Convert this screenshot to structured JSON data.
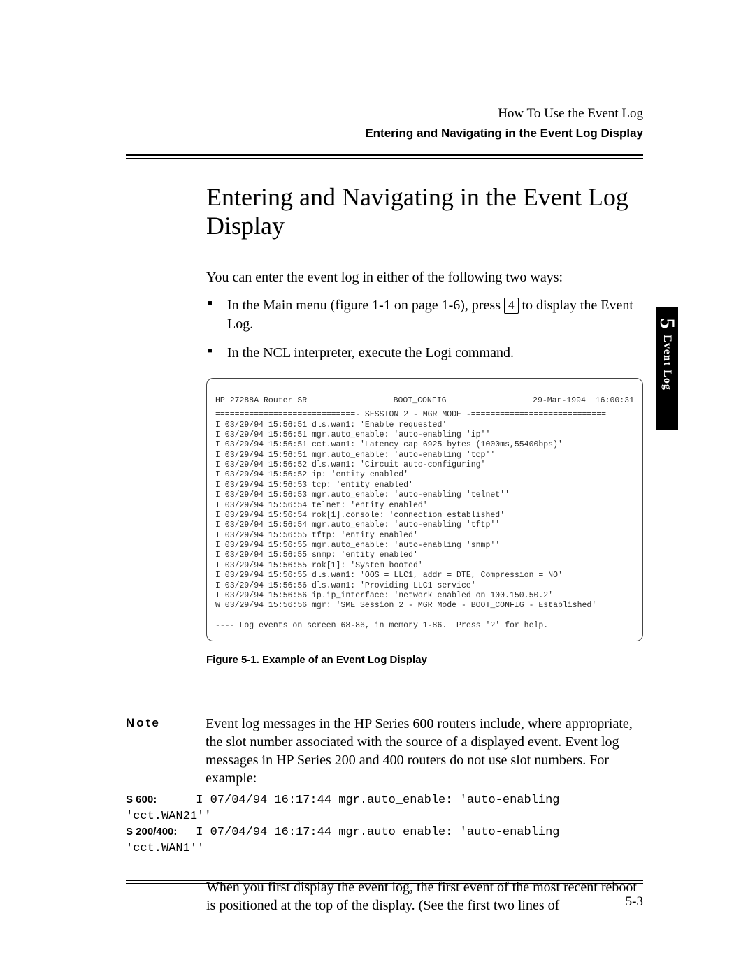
{
  "header": {
    "chapter_running_head": "How To Use the Event Log",
    "section_running_head": "Entering and Navigating in the Event Log Display"
  },
  "section": {
    "title": "Entering and Navigating in the Event Log Display",
    "intro": "You can enter the event log in either of the following two ways:",
    "bullets": {
      "b1_pre": "In the Main menu (figure 1-1 on page 1-6), press ",
      "b1_key": "4",
      "b1_post": " to display the Event Log.",
      "b2": "In the NCL interpreter, execute the Logi command."
    }
  },
  "terminal": {
    "head_left": "HP 27288A Router SR",
    "head_mid": "BOOT_CONFIG",
    "head_right": "29-Mar-1994  16:00:31",
    "rule": "=============================- SESSION 2 - MGR MODE -============================",
    "lines": [
      "I 03/29/94 15:56:51 dls.wan1: 'Enable requested'",
      "I 03/29/94 15:56:51 mgr.auto_enable: 'auto-enabling 'ip''",
      "I 03/29/94 15:56:51 cct.wan1: 'Latency cap 6925 bytes (1000ms,55400bps)'",
      "I 03/29/94 15:56:51 mgr.auto_enable: 'auto-enabling 'tcp''",
      "I 03/29/94 15:56:52 dls.wan1: 'Circuit auto-configuring'",
      "I 03/29/94 15:56:52 ip: 'entity enabled'",
      "I 03/29/94 15:56:53 tcp: 'entity enabled'",
      "I 03/29/94 15:56:53 mgr.auto_enable: 'auto-enabling 'telnet''",
      "I 03/29/94 15:56:54 telnet: 'entity enabled'",
      "I 03/29/94 15:56:54 rok[1].console: 'connection established'",
      "I 03/29/94 15:56:54 mgr.auto_enable: 'auto-enabling 'tftp''",
      "I 03/29/94 15:56:55 tftp: 'entity enabled'",
      "I 03/29/94 15:56:55 mgr.auto_enable: 'auto-enabling 'snmp''",
      "I 03/29/94 15:56:55 snmp: 'entity enabled'",
      "I 03/29/94 15:56:55 rok[1]: 'System booted'",
      "I 03/29/94 15:56:55 dls.wan1: 'OOS = LLC1, addr = DTE, Compression = NO'",
      "I 03/29/94 15:56:56 dls.wan1: 'Providing LLC1 service'",
      "I 03/29/94 15:56:56 ip.ip_interface: 'network enabled on 100.150.50.2'",
      "W 03/29/94 15:56:56 mgr: 'SME Session 2 - MGR Mode - BOOT_CONFIG - Established'"
    ],
    "footer": "---- Log events on screen 68-86, in memory 1-86.  Press '?' for help."
  },
  "figure_caption": "Figure  5-1.  Example of an Event Log Display",
  "note": {
    "label": "Note",
    "para": "Event log messages in the HP Series 600 routers include, where appropriate, the slot number associated with the source of a displayed event. Event log messages in HP Series 200 and 400 routers do not use slot numbers. For example:",
    "mono": {
      "s600_label": "S 600:",
      "s600_line": "I 07/04/94 16:17:44 mgr.auto_enable: 'auto-enabling 'cct.WAN21''",
      "s200_label": "S 200/400:",
      "s200_line": "I 07/04/94 16:17:44 mgr.auto_enable: 'auto-enabling 'cct.WAN1''"
    },
    "after": "When you first display the event log, the first event of the most recent reboot  is positioned at the top of the display. (See the first two lines of"
  },
  "sidetab": {
    "number": "5",
    "text": "Event Log"
  },
  "page_number": "5-3"
}
